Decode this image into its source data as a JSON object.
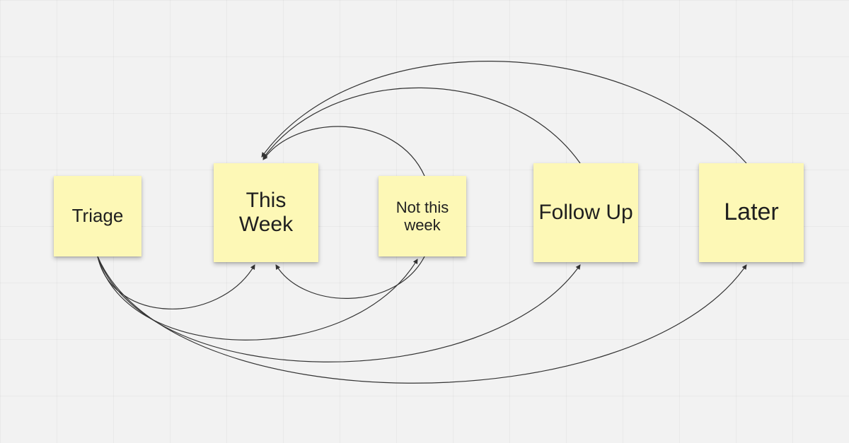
{
  "notes": {
    "triage": {
      "label": "Triage"
    },
    "thisWeek": {
      "label": "This Week"
    },
    "notThis": {
      "label": "Not this week"
    },
    "followUp": {
      "label": "Follow Up"
    },
    "later": {
      "label": "Later"
    }
  },
  "edges_description": "Arrows: Triage→ThisWeek, Triage→NotThisWeek, Triage→FollowUp, Triage→Later (all below). NotThisWeek→ThisWeek, FollowUp→ThisWeek, Later→ThisWeek (all above). NotThisWeek→ThisWeek also below.",
  "colors": {
    "note_bg": "#fdf8b6",
    "arrow": "#333333",
    "canvas_bg": "#f2f2f2"
  }
}
